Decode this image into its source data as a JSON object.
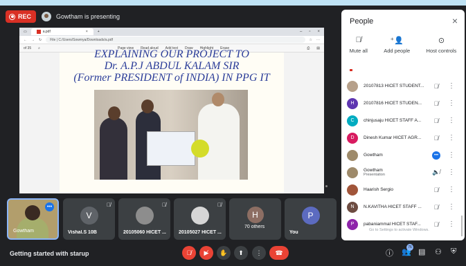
{
  "recording": {
    "label": "REC"
  },
  "presenter": {
    "text": "Gowtham is presenting"
  },
  "shared_screen": {
    "tab_title": "a.pdf",
    "address": "File  |  C:/Users/Sowmya/Downloads/a.pdf",
    "page_indicator": "of 35",
    "toolbar": [
      "Page view",
      "Read aloud",
      "Add text",
      "Draw",
      "Highlight",
      "Erase"
    ],
    "document_lines": [
      "EXPLAINING OUR PROJECT TO",
      "Dr. A.P.J ABDUL KALAM SIR",
      "(Former PRESIDENT of INDIA) IN PPG IT"
    ]
  },
  "tiles": [
    {
      "name": "Gowtham",
      "initial": "",
      "color": ""
    },
    {
      "name": "Vishal.S 10B",
      "initial": "V",
      "color": "#5f6368"
    },
    {
      "name": "20105060 HICET ...",
      "initial": "",
      "color": "#8d8d8d"
    },
    {
      "name": "20105027 HICET ...",
      "initial": "",
      "color": "#d6d6d6"
    },
    {
      "name": "70 others",
      "initial": "H",
      "color": "#8d6e63"
    },
    {
      "name": "You",
      "initial": "P",
      "color": "#5c6bc0"
    }
  ],
  "meeting_title": "Getting started with starup",
  "participants_count": "76",
  "people_panel": {
    "title": "People",
    "actions": [
      {
        "label": "Mute all",
        "icon": "mute-all-icon"
      },
      {
        "label": "Add people",
        "icon": "add-person-icon"
      },
      {
        "label": "Host controls",
        "icon": "host-controls-icon"
      }
    ],
    "participants": [
      {
        "name": "20107813 HICET STUDENT...",
        "sub": "",
        "initial": "",
        "color": "#b6a08a",
        "status": "muted"
      },
      {
        "name": "20107816 HICET STUDEN...",
        "sub": "",
        "initial": "H",
        "color": "#5e35b1",
        "status": "muted"
      },
      {
        "name": "chinjusaju HICET STAFF A...",
        "sub": "",
        "initial": "C",
        "color": "#00acc1",
        "status": "muted"
      },
      {
        "name": "Dinesh Kumar HICET AGR...",
        "sub": "",
        "initial": "D",
        "color": "#d81b60",
        "status": "muted"
      },
      {
        "name": "Gowtham",
        "sub": "",
        "initial": "",
        "color": "#9e8a6a",
        "status": "more"
      },
      {
        "name": "Gowtham",
        "sub": "Presentation",
        "initial": "",
        "color": "#9e8a6a",
        "status": "presenting"
      },
      {
        "name": "Haarish Sergio",
        "sub": "",
        "initial": "",
        "color": "#a1553a",
        "status": "muted"
      },
      {
        "name": "N.KAVITHA HICET STAFF ...",
        "sub": "",
        "initial": "N",
        "color": "#6d4c41",
        "status": "muted"
      },
      {
        "name": "pabaniammal HICET STAF...",
        "sub": "",
        "initial": "P",
        "color": "#8e24aa",
        "status": "muted"
      }
    ],
    "watermark": "Go to Settings to activate Windows."
  }
}
